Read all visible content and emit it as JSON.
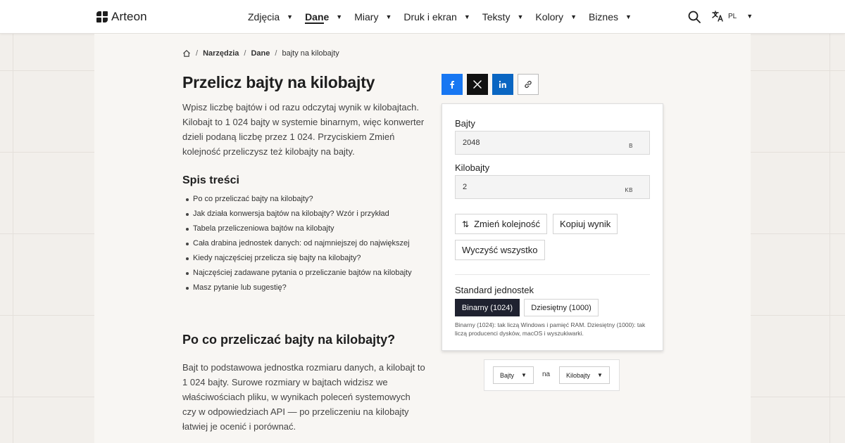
{
  "brand": {
    "name": "Arteon"
  },
  "nav": {
    "items": [
      {
        "label": "Zdjęcia"
      },
      {
        "label": "Dane"
      },
      {
        "label": "Miary"
      },
      {
        "label": "Druk i ekran"
      },
      {
        "label": "Teksty"
      },
      {
        "label": "Kolory"
      },
      {
        "label": "Biznes"
      }
    ],
    "active": "Dane",
    "language": "PL"
  },
  "breadcrumb": {
    "items": [
      "Narzędzia",
      "Dane",
      "bajty na kilobajty"
    ]
  },
  "page": {
    "title": "Przelicz bajty na kilobajty",
    "intro": "Wpisz liczbę bajtów i od razu odczytaj wynik w kilobajtach. Kilobajt to 1 024 bajty w systemie binarnym, więc konwerter dzieli podaną liczbę przez 1 024. Przyciskiem Zmień kolejność przeliczysz też kilobajty na bajty.",
    "toc_title": "Spis treści",
    "toc": [
      "Po co przeliczać bajty na kilobajty?",
      "Jak działa konwersja bajtów na kilobajty? Wzór i przykład",
      "Tabela przeliczeniowa bajtów na kilobajty",
      "Cała drabina jednostek danych: od najmniejszej do największej",
      "Kiedy najczęściej przelicza się bajty na kilobajty?",
      "Najczęściej zadawane pytania o przeliczanie bajtów na kilobajty",
      "Masz pytanie lub sugestię?"
    ],
    "section_title": "Po co przeliczać bajty na kilobajty?",
    "section_text": "Bajt to podstawowa jednostka rozmiaru danych, a kilobajt to 1 024 bajty. Surowe rozmiary w bajtach widzisz we właściwościach pliku, w wynikach poleceń systemowych czy w odpowiedziach API — po przeliczeniu na kilobajty łatwiej je ocenić i porównać."
  },
  "share": {
    "icons": [
      "facebook-icon",
      "x-icon",
      "linkedin-icon",
      "link-icon"
    ],
    "colors": {
      "facebook": "#1877f2",
      "x": "#111111",
      "linkedin": "#0a66c2"
    }
  },
  "converter": {
    "input_label": "Bajty",
    "input_value": "2048",
    "input_unit": "B",
    "output_label": "Kilobajty",
    "output_value": "2",
    "output_unit": "KB",
    "swap_label": "Zmień kolejność",
    "copy_label": "Kopiuj wynik",
    "clear_label": "Wyczyść wszystko",
    "standard_label": "Standard jednostek",
    "standard_options": [
      "Binarny (1024)",
      "Dziesiętny (1000)"
    ],
    "standard_selected": "Binarny (1024)",
    "standard_note": "Binarny (1024): tak liczą Windows i pamięć RAM. Dziesiętny (1000): tak liczą producenci dysków, macOS i wyszukiwarki."
  },
  "unit_picker": {
    "from": "Bajty",
    "connector": "na",
    "to": "Kilobajty"
  }
}
